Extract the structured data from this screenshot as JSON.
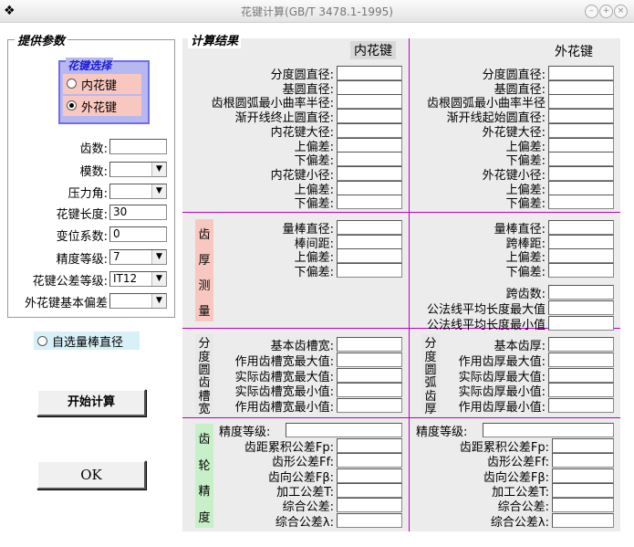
{
  "window": {
    "title": "花键计算(GB/T 3478.1-1995)",
    "icon": "app-icon",
    "buttons": [
      "minimize-icon",
      "maximize-icon",
      "close-icon"
    ]
  },
  "params": {
    "legend": "提供参数",
    "spline_select": {
      "legend": "花键选择",
      "options": [
        "内花键",
        "外花键"
      ],
      "selected": "外花键"
    },
    "fields": [
      {
        "label": "齿数:",
        "value": "",
        "type": "text"
      },
      {
        "label": "模数:",
        "value": "",
        "type": "select"
      },
      {
        "label": "压力角:",
        "value": "",
        "type": "select"
      },
      {
        "label": "花键长度:",
        "value": "30",
        "type": "text"
      },
      {
        "label": "变位系数:",
        "value": "0",
        "type": "text"
      },
      {
        "label": "精度等级:",
        "value": "7",
        "type": "select"
      },
      {
        "label": "花键公差等级:",
        "value": "IT12",
        "type": "select"
      },
      {
        "label": "外花键基本偏差",
        "value": "",
        "type": "select"
      }
    ],
    "custom_radio": "自选量棒直径",
    "calc_button": "开始计算",
    "ok_button": "OK"
  },
  "results": {
    "legend": "计算结果",
    "inner_head": "内花键",
    "outer_head": "外花键",
    "sec1_inner": [
      "分度圆直径:",
      "基圆直径:",
      "齿根圆弧最小曲率半径:",
      "渐开线终止圆直径:",
      "内花键大径:",
      "上偏差:",
      "下偏差:",
      "内花键小径:",
      "上偏差:",
      "下偏差:"
    ],
    "sec1_outer": [
      "分度圆直径:",
      "基圆直径:",
      "齿根圆弧最小曲率半径",
      "渐开线起始圆直径:",
      "外花键大径:",
      "上偏差:",
      "下偏差:",
      "外花键小径:",
      "上偏差:",
      "下偏差:"
    ],
    "sec2_vlabel": [
      "齿",
      "厚",
      "测",
      "量"
    ],
    "sec2_inner": [
      "量棒直径:",
      "棒间距:",
      "上偏差:",
      "下偏差:"
    ],
    "sec2_outer": [
      "量棒直径:",
      "跨棒距:",
      "上偏差:",
      "下偏差:",
      "跨齿数:",
      "公法线平均长度最大值",
      "公法线平均长度最小值"
    ],
    "sec3_vlabel_inner": [
      "分",
      "度",
      "圆",
      "齿",
      "槽",
      "宽"
    ],
    "sec3_vlabel_outer": [
      "分",
      "度",
      "圆",
      "弧",
      "齿",
      "厚"
    ],
    "sec3_inner": [
      "基本齿槽宽:",
      "作用齿槽宽最大值:",
      "实际齿槽宽最大值:",
      "实际齿槽宽最小值:",
      "作用齿槽宽最小值:"
    ],
    "sec3_outer": [
      "基本齿厚:",
      "作用齿厚最大值:",
      "实际齿厚最大值:",
      "实际齿厚最小值:",
      "作用齿厚最小值:"
    ],
    "sec4_vlabel": [
      "齿",
      "轮",
      "精",
      "度"
    ],
    "sec4_grade_inner": "精度等级:",
    "sec4_grade_outer": "精度等级:",
    "sec4_inner": [
      "齿距累积公差Fp:",
      "齿形公差Ff:",
      "齿向公差Fβ:",
      "加工公差T:",
      "综合公差:",
      "综合公差λ:"
    ],
    "sec4_outer": [
      "齿距累积公差Fp:",
      "齿形公差Ff:",
      "齿向公差Fβ:",
      "加工公差T:",
      "综合公差:",
      "综合公差λ:"
    ]
  },
  "colors": {
    "accent": "#c000c0",
    "select_group": "#b8b8f0",
    "radio_bg": "#f8c8c0",
    "vlabel_pink": "#f8c8c0",
    "vlabel_green": "#c8f0c8"
  }
}
